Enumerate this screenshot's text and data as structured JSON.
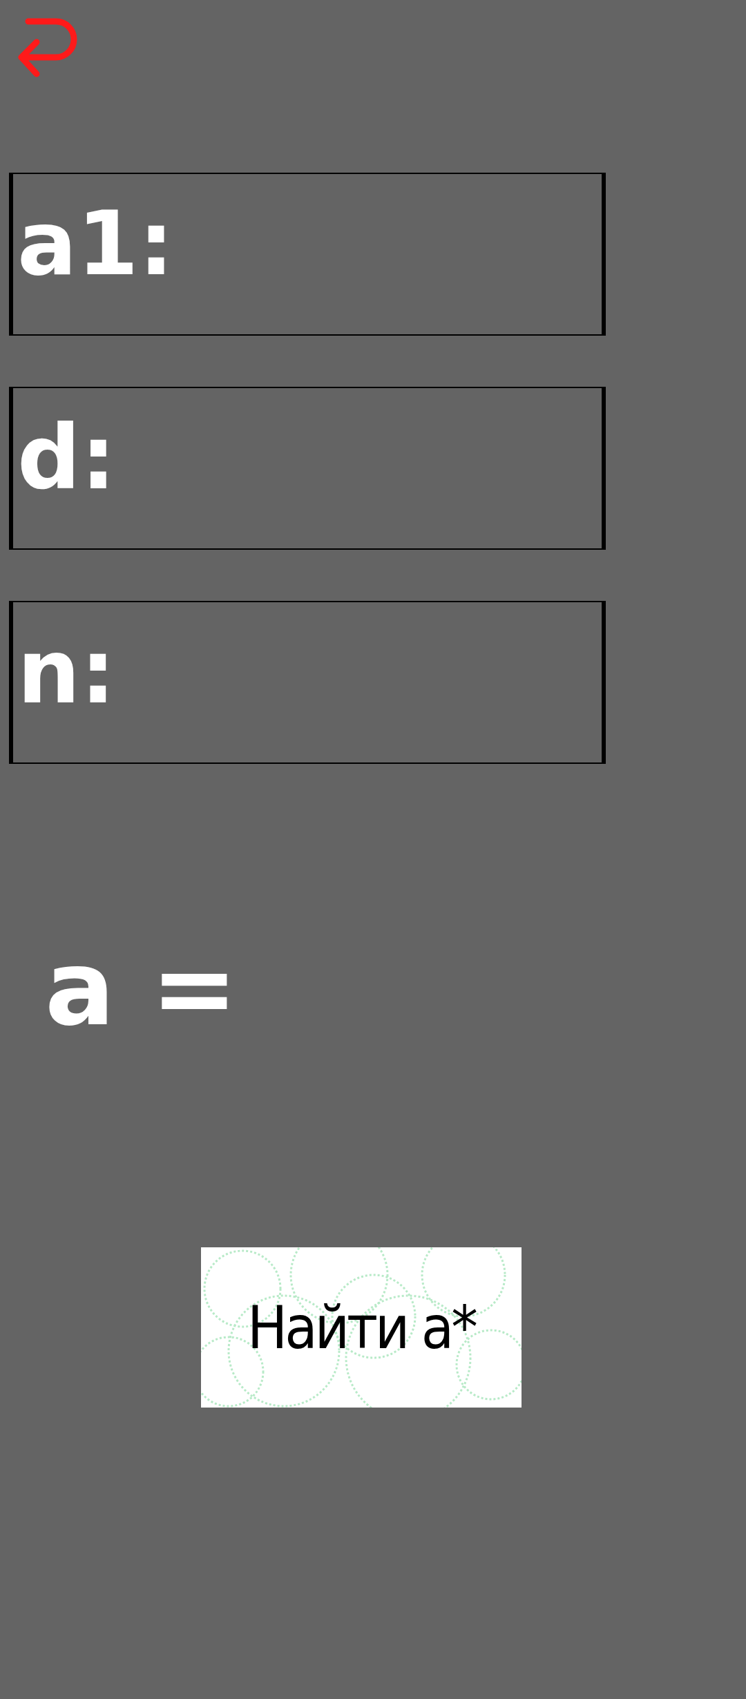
{
  "fields": [
    {
      "label": "a1:"
    },
    {
      "label": "d:"
    },
    {
      "label": "n:"
    }
  ],
  "result": {
    "label": "a ="
  },
  "find_button": {
    "label": "Найти a*"
  }
}
